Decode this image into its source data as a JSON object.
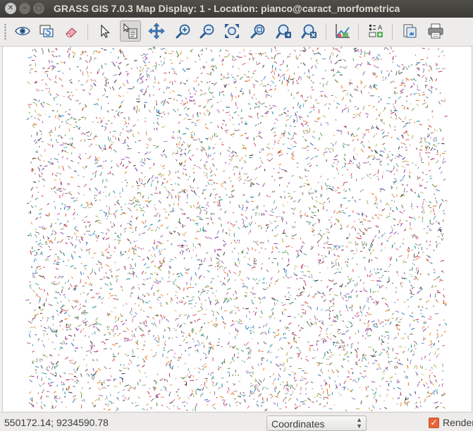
{
  "window": {
    "title": "GRASS GIS 7.0.3 Map Display: 1  - Location: pianco@caract_morfometrica",
    "controls": [
      "close",
      "minimize",
      "maximize"
    ]
  },
  "toolbar": {
    "tools": [
      {
        "name": "display-map-icon",
        "label": "Display map"
      },
      {
        "name": "render-map-icon",
        "label": "Render map"
      },
      {
        "name": "erase-display-icon",
        "label": "Erase display"
      },
      {
        "name": "pointer-icon",
        "label": "Pointer"
      },
      {
        "name": "query-icon",
        "label": "Query raster/vector map(s)",
        "active": true
      },
      {
        "name": "pan-icon",
        "label": "Pan"
      },
      {
        "name": "zoom-in-icon",
        "label": "Zoom in"
      },
      {
        "name": "zoom-out-icon",
        "label": "Zoom out"
      },
      {
        "name": "zoom-extent-icon",
        "label": "Zoom to selected map layer(s)"
      },
      {
        "name": "zoom-back-icon",
        "label": "Return to previous zoom"
      },
      {
        "name": "zoom-menu-icon",
        "label": "Various zoom options"
      },
      {
        "name": "zoom-region-icon",
        "label": "Zoom to computational region"
      },
      {
        "name": "analyze-icon",
        "label": "Analyze"
      },
      {
        "name": "overlay-icon",
        "label": "Add map elements"
      },
      {
        "name": "save-display-icon",
        "label": "Save display to file"
      },
      {
        "name": "print-icon",
        "label": "Print display"
      }
    ]
  },
  "map": {
    "dot_colors": [
      "#1e1e1e",
      "#7a1fa2",
      "#2e7d32",
      "#c62828",
      "#1565c0",
      "#ef6c00",
      "#00838f",
      "#6d4c41",
      "#9e9d24",
      "#ad1457"
    ]
  },
  "statusbar": {
    "coordinates": "550172.14; 9234590.78",
    "mode_selected": "Coordinates",
    "render_label": "Render",
    "render_checked": true
  },
  "colors": {
    "titlebar": "#3c3b37",
    "checkbox_accent": "#e9643a"
  }
}
